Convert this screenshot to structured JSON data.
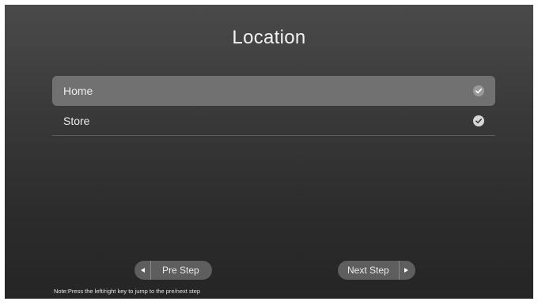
{
  "page": {
    "title": "Location"
  },
  "options": [
    {
      "label": "Home",
      "selected": true,
      "checked": true
    },
    {
      "label": "Store",
      "selected": false,
      "checked": true
    }
  ],
  "buttons": {
    "pre_step": "Pre Step",
    "next_step": "Next Step"
  },
  "note": "Note:Press the left/right key to jump to the pre/next step",
  "icons": {
    "check": "check-circle-icon",
    "left": "arrow-left-icon",
    "right": "arrow-right-icon"
  },
  "colors": {
    "selected_row": "#717171",
    "button_bg": "#5e5e5e",
    "text": "#ededed"
  }
}
